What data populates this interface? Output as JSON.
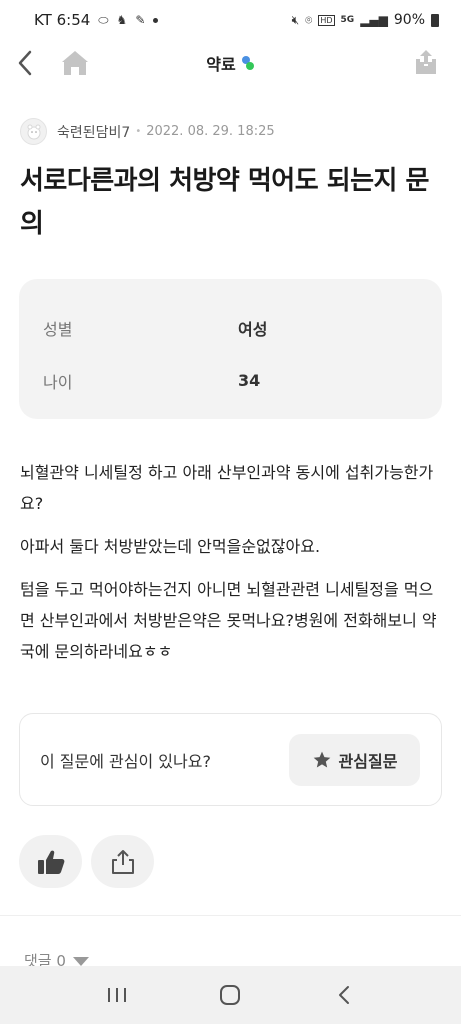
{
  "status_bar": {
    "carrier_time": "KT 6:54",
    "battery": "90%",
    "network": "5G"
  },
  "header": {
    "title": "약료"
  },
  "post": {
    "author": "숙련된담비7",
    "date": "2022. 08. 29. 18:25",
    "title": "서로다른과의 처방약 먹어도 되는지 문의",
    "info": [
      {
        "label": "성별",
        "value": "여성"
      },
      {
        "label": "나이",
        "value": "34"
      }
    ],
    "paragraphs": [
      "뇌혈관약 니세틸정 하고 아래 산부인과약 동시에 섭취가능한가요?",
      "아파서 둘다 처방받았는데 안먹을순없잖아요.",
      "텀을 두고 먹어야하는건지 아니면 뇌혈관관련 니세틸정을 먹으면 산부인과에서 처방받은약은 못먹나요?병원에 전화해보니 약국에 문의하라네요ㅎㅎ"
    ]
  },
  "interest": {
    "question": "이 질문에 관심이 있나요?",
    "button_label": "관심질문"
  },
  "comments": {
    "label": "댓글 0"
  },
  "colors": {
    "accent_blue": "#4a90e2",
    "accent_green": "#34c759",
    "card_bg": "#f3f3f3"
  }
}
